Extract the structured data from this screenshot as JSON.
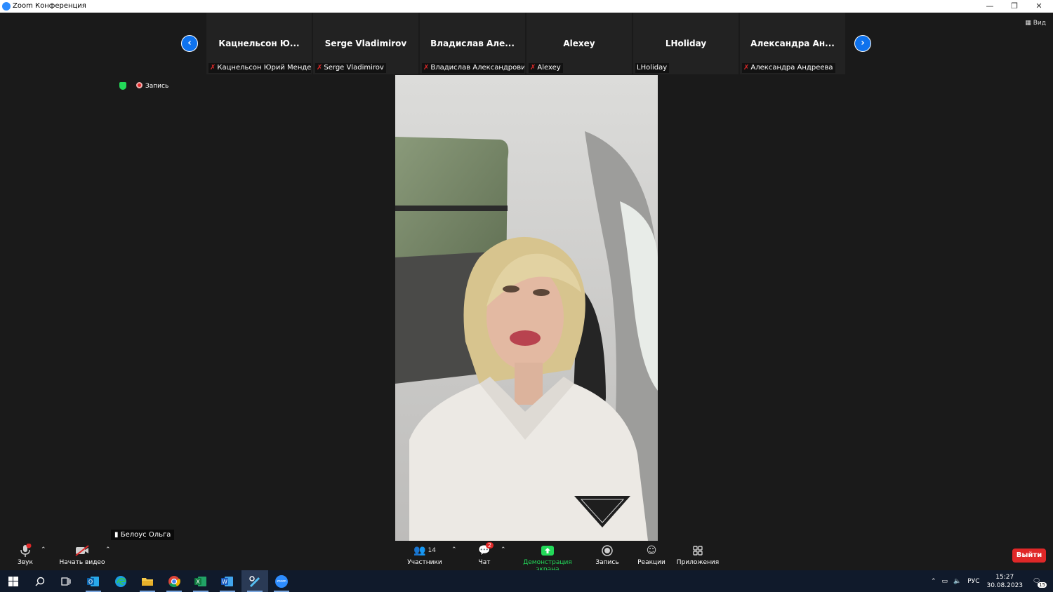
{
  "window": {
    "title": "Zoom Конференция",
    "controls": [
      "minimize-icon",
      "restore-icon",
      "close-icon"
    ]
  },
  "view_label": "Вид",
  "participants_strip": [
    {
      "big_name": "Кацнельсон Ю...",
      "label": "Кацнельсон Юрий Менде...",
      "muted": true
    },
    {
      "big_name": "Serge Vladimirov",
      "label": "Serge Vladimirov",
      "muted": true
    },
    {
      "big_name": "Владислав Але...",
      "label": "Владислав Александрович...",
      "muted": true
    },
    {
      "big_name": "Alexey",
      "label": "Alexey",
      "muted": true
    },
    {
      "big_name": "LHoliday",
      "label": "LHoliday",
      "muted": false
    },
    {
      "big_name": "Александра Ан...",
      "label": "Александра Андреева",
      "muted": true
    }
  ],
  "recording_label": "Запись",
  "speaker_name": "Белоус Ольга",
  "toolbar": {
    "audio_label": "Звук",
    "video_label": "Начать видео",
    "participants_label": "Участники",
    "participants_count": "14",
    "chat_label": "Чат",
    "chat_badge": "2",
    "share_label": "Демонстрация экрана",
    "record_label": "Запись",
    "reactions_label": "Реакции",
    "apps_label": "Приложения",
    "leave_label": "Выйти"
  },
  "taskbar": {
    "apps": [
      "windows-start-icon",
      "search-icon",
      "task-view-icon",
      "outlook-icon",
      "edge-icon",
      "file-explorer-icon",
      "chrome-icon",
      "excel-icon",
      "word-icon",
      "snipping-tool-icon",
      "zoom-icon"
    ],
    "zoom_label": "zoom",
    "language": "РУС",
    "time": "15:27",
    "date": "30.08.2023",
    "notifications": "15"
  },
  "colors": {
    "zoom_blue": "#0e72ed",
    "mute_red": "#e02828",
    "share_green": "#23d959",
    "background": "#1a1a1a",
    "taskbar": "#101a2b"
  }
}
